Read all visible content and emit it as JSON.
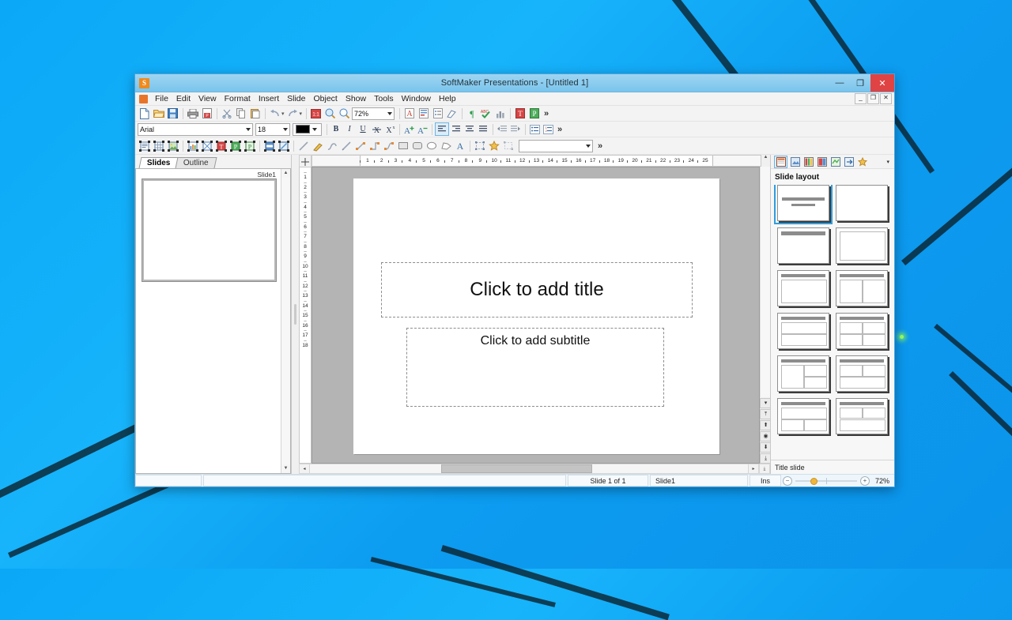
{
  "window": {
    "title": "SoftMaker Presentations - [Untitled 1]",
    "app_icon_letter": "S",
    "controls": {
      "minimize": "—",
      "maximize": "❐",
      "close": "✕"
    },
    "mdi_controls": {
      "minimize": "_",
      "restore": "❐",
      "close": "✕"
    }
  },
  "menubar": {
    "items": [
      "File",
      "Edit",
      "View",
      "Format",
      "Insert",
      "Slide",
      "Object",
      "Show",
      "Tools",
      "Window",
      "Help"
    ]
  },
  "toolbar_standard": {
    "zoom_value": "72%",
    "overflow": "»",
    "buttons": [
      "new-document-icon",
      "open-folder-icon",
      "save-icon",
      "print-icon",
      "export-pdf-icon",
      "cut-scissors-icon",
      "copy-icon",
      "paste-icon",
      "undo-icon",
      "redo-icon",
      "zoom-100-icon",
      "zoom-selection-icon",
      "zoom-magnifier-icon",
      "character-format-icon",
      "paragraph-format-icon",
      "bullet-list-icon",
      "format-painter-icon",
      "show-marks-icon",
      "spellcheck-icon",
      "chart-icon",
      "text-frame-icon",
      "presentation-icon"
    ]
  },
  "toolbar_formatting": {
    "font_name": "Arial",
    "font_size": "18",
    "font_color": "#000000",
    "overflow": "»",
    "buttons": [
      "bold-icon",
      "italic-icon",
      "underline-icon",
      "strikethrough-icon",
      "superscript-icon",
      "grow-font-icon",
      "shrink-font-icon",
      "align-left-icon",
      "align-right-icon",
      "align-center-icon",
      "align-justify-icon",
      "decrease-indent-icon",
      "increase-indent-icon",
      "bullets-icon",
      "numbering-icon"
    ]
  },
  "toolbar_objects": {
    "style_value": "",
    "overflow": "»",
    "buttons": [
      "text-placeholder-icon",
      "table-icon",
      "picture-icon",
      "chart-object-icon",
      "object-icon",
      "title-object-icon",
      "presentation-object-icon",
      "placeholder-object-icon",
      "media-icon",
      "ole-object-icon",
      "line-icon",
      "freehand-icon",
      "curve-icon",
      "pencil-line-icon",
      "connector-straight-icon",
      "connector-elbow-icon",
      "connector-curved-icon",
      "rectangle-icon",
      "rounded-rectangle-icon",
      "ellipse-icon",
      "polygon-icon",
      "text-art-icon",
      "group-icon",
      "autoshape-star-icon",
      "ungroup-icon"
    ]
  },
  "left_pane": {
    "tabs": [
      {
        "label": "Slides",
        "selected": true
      },
      {
        "label": "Outline",
        "selected": false
      }
    ],
    "thumbnail_label": "Slide1"
  },
  "rulers": {
    "horizontal_ticks": [
      "1",
      "2",
      "3",
      "4",
      "5",
      "6",
      "7",
      "8",
      "9",
      "10",
      "11",
      "12",
      "13",
      "14",
      "15",
      "16",
      "17",
      "18",
      "19",
      "20",
      "21",
      "22",
      "23",
      "24",
      "25"
    ],
    "vertical_ticks": [
      "1",
      "2",
      "3",
      "4",
      "5",
      "6",
      "7",
      "8",
      "9",
      "10",
      "11",
      "12",
      "13",
      "14",
      "15",
      "16",
      "17",
      "18"
    ]
  },
  "slide": {
    "title_placeholder": "Click to add title",
    "subtitle_placeholder": "Click to add subtitle"
  },
  "right_pane": {
    "panel_title": "Slide layout",
    "selected_layout_name": "Title slide",
    "toolbar_buttons": [
      "slide-layout-icon",
      "design-icon",
      "color-scheme-icon",
      "background-icon",
      "animation-icon",
      "transition-icon",
      "favorites-star-icon"
    ],
    "dropdown": "▾",
    "layouts": [
      {
        "name": "title-slide",
        "selected": true
      },
      {
        "name": "blank",
        "selected": false
      },
      {
        "name": "title-only",
        "selected": false
      },
      {
        "name": "title-content-box",
        "selected": false
      },
      {
        "name": "title-and-content",
        "selected": false
      },
      {
        "name": "title-two-content",
        "selected": false
      },
      {
        "name": "title-content-over-content",
        "selected": false
      },
      {
        "name": "title-four-content",
        "selected": false
      },
      {
        "name": "title-content-two-below",
        "selected": false
      },
      {
        "name": "title-two-content-over-content",
        "selected": false
      },
      {
        "name": "title-content-two-bottom",
        "selected": false
      },
      {
        "name": "title-two-top-content-bottom",
        "selected": false
      }
    ]
  },
  "statusbar": {
    "slide_counter": "Slide 1 of 1",
    "slide_name": "Slide1",
    "insert_mode": "Ins",
    "zoom_out": "−",
    "zoom_in": "+",
    "zoom_value": "72%"
  }
}
